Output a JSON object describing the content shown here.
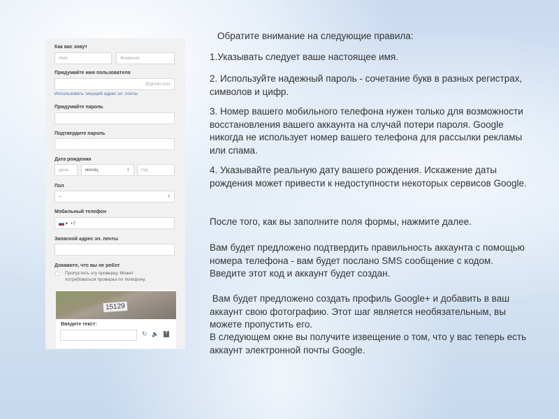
{
  "form": {
    "name_label": "Как вас зовут",
    "first_placeholder": "Имя",
    "last_placeholder": "Фамилия",
    "username_label": "Придумайте имя пользователя",
    "username_suffix": "@gmail.com",
    "use_current_link": "Использовать текущий адрес эл. почты",
    "password_label": "Придумайте пароль",
    "confirm_label": "Подтвердите пароль",
    "birth_label": "Дата рождения",
    "day_placeholder": "день",
    "month_value": "месяц",
    "year_placeholder": "год",
    "gender_label": "Пол",
    "gender_value": "--",
    "phone_label": "Мобильный телефон",
    "phone_code": "+7",
    "backup_label": "Запасной адрес эл. почты",
    "robot_label": "Докажите, что вы не робот",
    "skip_text": "Пропустить эту проверку. Может потребоваться проверка по телефону.",
    "captcha_text": "15129",
    "enter_text_label": "Введите текст:"
  },
  "rules": {
    "title": "Обратите внимание на следующие правила:",
    "r1": "1.Указывать следует ваше настоящее имя.",
    "r2": "2. Используйте надежный пароль - сочетание букв в разных регистрах, символов и цифр.",
    "r3": "3. Номер вашего мобильного телефона нужен только для возможности восстановления вашего аккаунта на случай потери пароля. Google никогда не использует номер вашего телефона для рассылки рекламы или спама.",
    "r4": "4. Указывайте реальную дату вашего рождения. Искажение даты рождения может привести к недоступности некоторых сервисов Google.",
    "p1": "После того, как вы заполните поля формы, нажмите далее.",
    "p2": "Вам будет предложено подтвердить правильность аккаунта с помощью номера телефона - вам будет послано SMS сообщение с кодом. Введите этот код и аккаунт будет создан.",
    "p3": " Вам будет предложено создать профиль Google+ и добавить в ваш аккаунт свою фотографию. Этот шаг является необязательным, вы можете пропустить его.",
    "p4": "В следующем окне вы получите извещение о том, что у вас теперь есть аккаунт электронной почты Google."
  }
}
